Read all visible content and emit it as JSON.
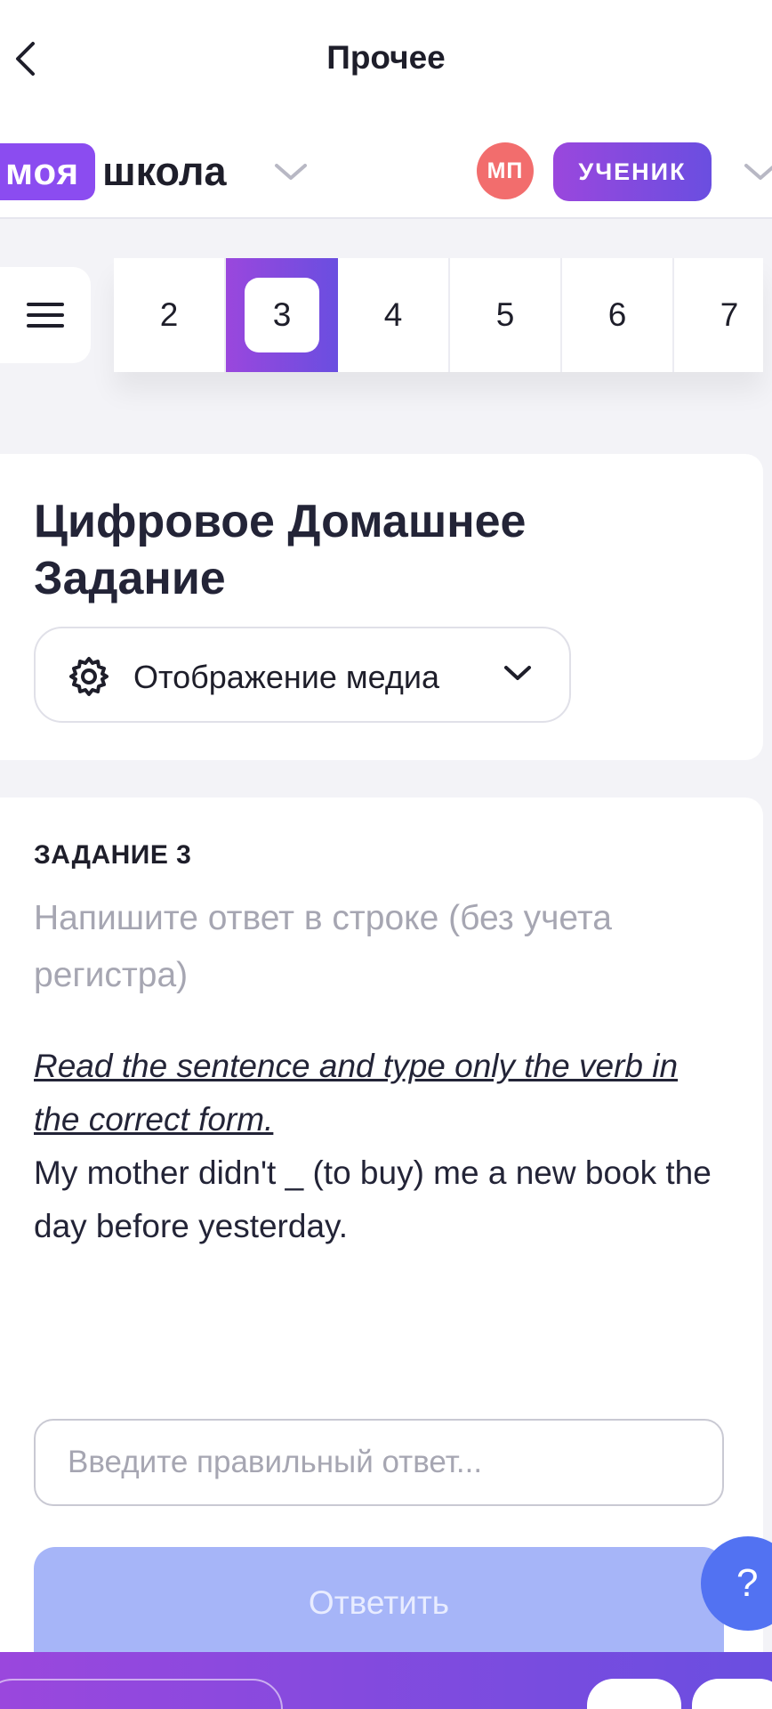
{
  "nav": {
    "title": "Прочее"
  },
  "header": {
    "logo_badge": "моя",
    "logo_text": "школа",
    "avatar_initials": "МП",
    "role": "УЧЕНИК"
  },
  "pager": {
    "pages": [
      "2",
      "3",
      "4",
      "5",
      "6",
      "7"
    ],
    "active": "3"
  },
  "card": {
    "title": "Цифровое Домашнее Задание",
    "media_toggle_label": "Отображение медиа"
  },
  "task": {
    "number": "ЗАДАНИЕ 3",
    "hint": "Напишите ответ в строке (без учета регистра)",
    "instruction": "Read the sentence and type only the verb in the correct form.",
    "text": "My mother didn't _ (to buy) me a new book the day before yesterday.",
    "input_placeholder": "Введите правильный ответ...",
    "input_value": "",
    "submit_label": "Ответить"
  },
  "help": {
    "label": "?"
  },
  "colors": {
    "accent_start": "#9a47dd",
    "accent_end": "#6a4ee0",
    "logo": "#8b4cf0",
    "avatar": "#f26d6d",
    "submit_disabled": "#a6b5f8",
    "help": "#5272f2"
  }
}
